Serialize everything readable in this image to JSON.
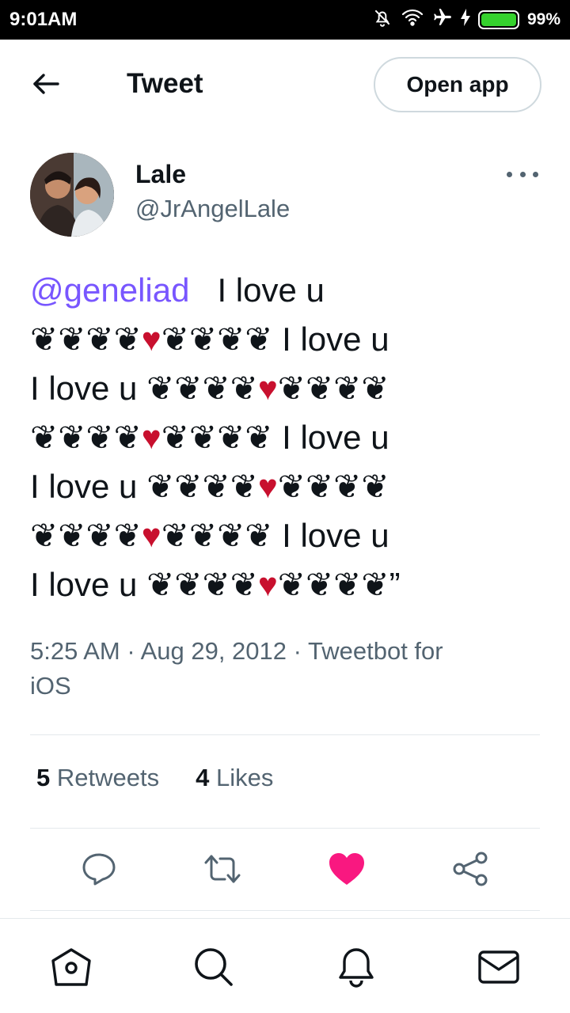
{
  "status_bar": {
    "time": "9:01AM",
    "battery_percent": "99%",
    "battery_level": 0.99,
    "icons": [
      "mute-icon",
      "wifi-icon",
      "airplane-icon",
      "charging-icon",
      "battery-icon"
    ]
  },
  "header": {
    "title": "Tweet",
    "back_icon": "arrow-left-icon",
    "open_app_label": "Open app"
  },
  "author": {
    "display_name": "Lale",
    "handle": "@JrAngelLale"
  },
  "tweet": {
    "mention": "@geneliad",
    "line0_text": "I love u",
    "line1_left": "❦❦❦❦",
    "line1_right": "❦❦❦❦ I love u",
    "line2_left": "I love u ❦❦❦❦",
    "line2_right": "❦❦❦❦",
    "line3_left": "❦❦❦❦",
    "line3_right": "❦❦❦❦ I love u",
    "line4_left": "I love u ❦❦❦❦",
    "line4_right": "❦❦❦❦",
    "line5_left": "❦❦❦❦",
    "line5_right": "❦❦❦❦ I love u",
    "line6_left": "I love u ❦❦❦❦",
    "line6_right": "❦❦❦❦”",
    "heart": "♥",
    "timestamp_line1": "5:25 AM · Aug 29, 2012 · Tweetbot for",
    "timestamp_line2": "iOS"
  },
  "stats": {
    "retweets_count": "5",
    "retweets_label": "Retweets",
    "likes_count": "4",
    "likes_label": "Likes"
  },
  "actions": [
    "reply-icon",
    "retweet-icon",
    "like-icon",
    "share-icon"
  ],
  "bottom_nav": [
    "home-icon",
    "search-icon",
    "notifications-icon",
    "messages-icon"
  ],
  "colors": {
    "mention": "#7856ff",
    "heart": "#c8102e",
    "like_active": "#f91880",
    "secondary_text": "#536471",
    "battery": "#35d22d"
  }
}
